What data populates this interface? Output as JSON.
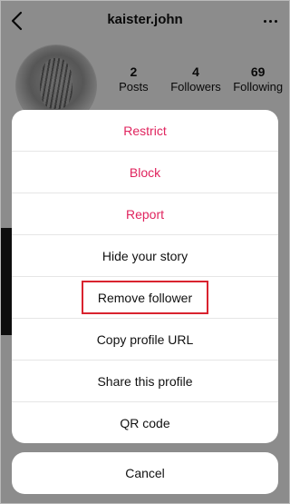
{
  "header": {
    "username": "kaister.john"
  },
  "profile": {
    "stats": [
      {
        "value": "2",
        "label": "Posts"
      },
      {
        "value": "4",
        "label": "Followers"
      },
      {
        "value": "69",
        "label": "Following"
      }
    ]
  },
  "sheet": {
    "items": [
      {
        "label": "Restrict"
      },
      {
        "label": "Block"
      },
      {
        "label": "Report"
      },
      {
        "label": "Hide your story"
      },
      {
        "label": "Remove follower"
      },
      {
        "label": "Copy profile URL"
      },
      {
        "label": "Share this profile"
      },
      {
        "label": "QR code"
      }
    ],
    "cancel_label": "Cancel"
  },
  "colors": {
    "danger": "#e0245e",
    "highlight": "#d9232f"
  }
}
